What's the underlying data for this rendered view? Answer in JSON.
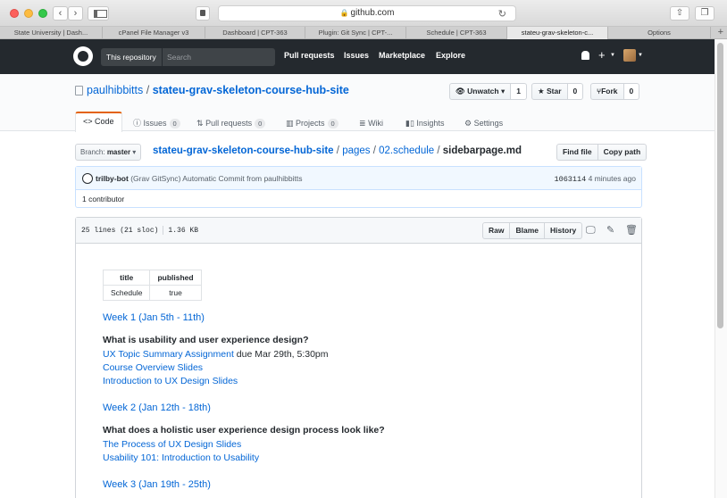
{
  "browser": {
    "address": "github.com",
    "tabs": [
      {
        "label": "State University | Dash..."
      },
      {
        "label": "cPanel File Manager v3"
      },
      {
        "label": "Dashboard | CPT-363"
      },
      {
        "label": "Plugin: Git Sync | CPT-..."
      },
      {
        "label": "Schedule | CPT-363"
      },
      {
        "label": "stateu-grav-skeleton-c..."
      },
      {
        "label": "Options"
      }
    ],
    "new_tab": "+"
  },
  "github_header": {
    "scope_label": "This repository",
    "search_placeholder": "Search",
    "nav": [
      "Pull requests",
      "Issues",
      "Marketplace",
      "Explore"
    ],
    "plus": "+"
  },
  "repo": {
    "owner": "paulhibbitts",
    "separator": "/",
    "name": "stateu-grav-skeleton-course-hub-site",
    "watch_label": "Unwatch",
    "watch_count": "1",
    "star_label": "Star",
    "star_count": "0",
    "fork_label": "Fork",
    "fork_count": "0"
  },
  "repo_nav": [
    {
      "label": "Code",
      "icon": "<>"
    },
    {
      "label": "Issues",
      "count": "0",
      "icon": "ⓘ"
    },
    {
      "label": "Pull requests",
      "count": "0",
      "icon": "⇅"
    },
    {
      "label": "Projects",
      "count": "0",
      "icon": "▥"
    },
    {
      "label": "Wiki",
      "icon": "≣"
    },
    {
      "label": "Insights",
      "icon": "📊"
    },
    {
      "label": "Settings",
      "icon": "⚙"
    }
  ],
  "file_nav": {
    "branch_prefix": "Branch:",
    "branch": "master",
    "path": [
      "stateu-grav-skeleton-course-hub-site",
      "pages",
      "02.schedule"
    ],
    "filename": "sidebarpage.md",
    "find_file": "Find file",
    "copy_path": "Copy path"
  },
  "commit": {
    "author": "trilby-bot",
    "message": "(Grav GitSync) Automatic Commit from paulhibbitts",
    "sha": "1063114",
    "time": "4 minutes ago",
    "contributors": "1 contributor"
  },
  "file": {
    "lines": "25 lines (21 sloc)",
    "size": "1.36 KB",
    "raw": "Raw",
    "blame": "Blame",
    "history": "History"
  },
  "markdown": {
    "table": {
      "headers": [
        "title",
        "published"
      ],
      "row": [
        "Schedule",
        "true"
      ]
    },
    "week1": {
      "heading": "Week 1 (Jan 5th - 11th)",
      "question": "What is usability and user experience design?",
      "assignment_link": "UX Topic Summary Assignment",
      "assignment_due": " due Mar 29th, 5:30pm",
      "links": [
        "Course Overview Slides",
        "Introduction to UX Design Slides"
      ]
    },
    "week2": {
      "heading": "Week 2 (Jan 12th - 18th)",
      "question": "What does a holistic user experience design process look like?",
      "links": [
        "The Process of UX Design Slides",
        "Usability 101: Introduction to Usability"
      ]
    },
    "week3": {
      "heading": "Week 3 (Jan 19th - 25th)"
    }
  }
}
